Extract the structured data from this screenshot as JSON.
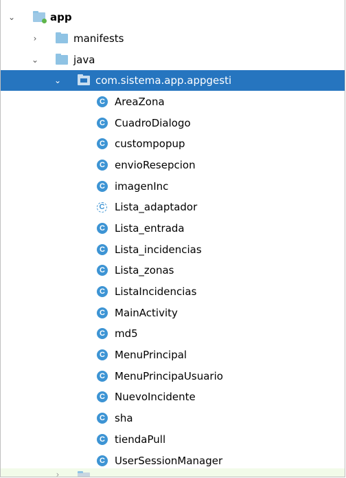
{
  "tree": {
    "app": {
      "label": "app",
      "arrow": "expanded"
    },
    "manifests": {
      "label": "manifests",
      "arrow": "collapsed"
    },
    "java": {
      "label": "java",
      "arrow": "expanded"
    },
    "package": {
      "label": "com.sistema.app.appgesti",
      "arrow": "expanded"
    },
    "classes": [
      {
        "label": "AreaZona",
        "icon": "class-icon"
      },
      {
        "label": "CuadroDialogo",
        "icon": "class-icon"
      },
      {
        "label": "custompopup",
        "icon": "class-icon"
      },
      {
        "label": "envioResepcion",
        "icon": "class-icon"
      },
      {
        "label": "imagenInc",
        "icon": "class-icon"
      },
      {
        "label": "Lista_adaptador",
        "icon": "abstract-class-icon"
      },
      {
        "label": "Lista_entrada",
        "icon": "class-icon"
      },
      {
        "label": "Lista_incidencias",
        "icon": "class-icon"
      },
      {
        "label": "Lista_zonas",
        "icon": "class-icon"
      },
      {
        "label": "ListaIncidencias",
        "icon": "class-icon"
      },
      {
        "label": "MainActivity",
        "icon": "class-icon"
      },
      {
        "label": "md5",
        "icon": "class-icon"
      },
      {
        "label": "MenuPrincipal",
        "icon": "class-icon"
      },
      {
        "label": "MenuPrincipaUsuario",
        "icon": "class-icon"
      },
      {
        "label": "NuevoIncidente",
        "icon": "class-icon"
      },
      {
        "label": "sha",
        "icon": "class-icon"
      },
      {
        "label": "tiendaPull",
        "icon": "class-icon"
      },
      {
        "label": "UserSessionManager",
        "icon": "class-icon"
      }
    ],
    "class_icon_glyph": "C"
  },
  "colors": {
    "selection": "#2675bf",
    "folder": "#8fc3e4",
    "class_icon": "#3d94d4",
    "app_badge": "#5fb54a"
  }
}
